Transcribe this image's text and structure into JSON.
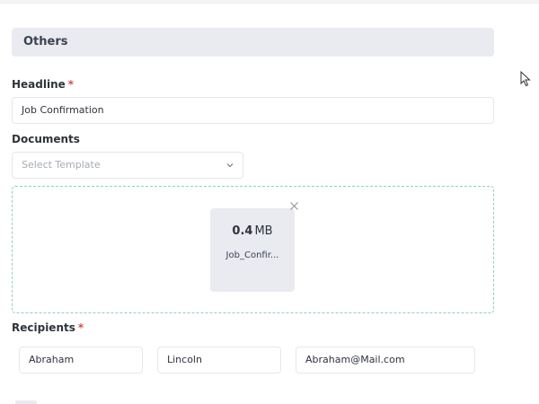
{
  "section": {
    "title": "Others"
  },
  "headline": {
    "label": "Headline",
    "required_mark": "*",
    "value": "Job Confirmation"
  },
  "documents": {
    "label": "Documents",
    "template_select": {
      "placeholder": "Select Template",
      "icon": "chevron-down-icon"
    },
    "files": [
      {
        "size_value": "0.4",
        "size_unit": "MB",
        "name": "Job_Confir...",
        "remove_icon": "close-icon"
      }
    ]
  },
  "recipients": {
    "label": "Recipients",
    "required_mark": "*",
    "first_name": "Abraham",
    "last_name": "Lincoln",
    "email": "Abraham@Mail.com"
  },
  "colors": {
    "section_bg": "#e9ebf0",
    "required": "#d94b4b",
    "dropzone_border": "#8bd3c0",
    "border": "#e5e7eb"
  }
}
